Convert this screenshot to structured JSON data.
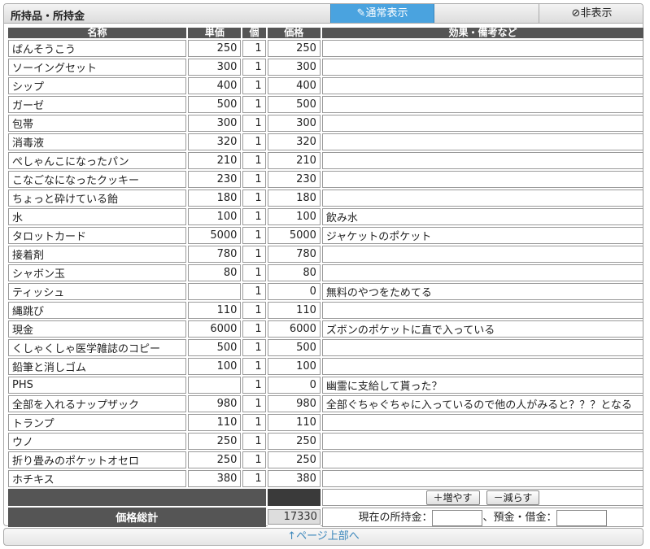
{
  "header": {
    "title": "所持品・所持金",
    "normal_label": "✎通常表示",
    "hide_label": "⊘非表示"
  },
  "table": {
    "columns": [
      "名称",
      "単価",
      "個",
      "価格",
      "効果・備考など"
    ],
    "rows": [
      {
        "name": "ばんそうこう",
        "unit": "250",
        "qty": "1",
        "price": "250",
        "note": ""
      },
      {
        "name": "ソーイングセット",
        "unit": "300",
        "qty": "1",
        "price": "300",
        "note": ""
      },
      {
        "name": "シップ",
        "unit": "400",
        "qty": "1",
        "price": "400",
        "note": ""
      },
      {
        "name": "ガーゼ",
        "unit": "500",
        "qty": "1",
        "price": "500",
        "note": ""
      },
      {
        "name": "包帯",
        "unit": "300",
        "qty": "1",
        "price": "300",
        "note": ""
      },
      {
        "name": "消毒液",
        "unit": "320",
        "qty": "1",
        "price": "320",
        "note": ""
      },
      {
        "name": "ぺしゃんこになったパン",
        "unit": "210",
        "qty": "1",
        "price": "210",
        "note": ""
      },
      {
        "name": "こなごなになったクッキー",
        "unit": "230",
        "qty": "1",
        "price": "230",
        "note": ""
      },
      {
        "name": "ちょっと砕けている飴",
        "unit": "180",
        "qty": "1",
        "price": "180",
        "note": ""
      },
      {
        "name": "水",
        "unit": "100",
        "qty": "1",
        "price": "100",
        "note": "飲み水"
      },
      {
        "name": "タロットカード",
        "unit": "5000",
        "qty": "1",
        "price": "5000",
        "note": "ジャケットのポケット"
      },
      {
        "name": "接着剤",
        "unit": "780",
        "qty": "1",
        "price": "780",
        "note": ""
      },
      {
        "name": "シャボン玉",
        "unit": "80",
        "qty": "1",
        "price": "80",
        "note": ""
      },
      {
        "name": "ティッシュ",
        "unit": "",
        "qty": "1",
        "price": "0",
        "note": "無料のやつをためてる"
      },
      {
        "name": "縄跳び",
        "unit": "110",
        "qty": "1",
        "price": "110",
        "note": ""
      },
      {
        "name": "現金",
        "unit": "6000",
        "qty": "1",
        "price": "6000",
        "note": "ズボンのポケットに直で入っている"
      },
      {
        "name": "くしゃくしゃ医学雑誌のコピー",
        "unit": "500",
        "qty": "1",
        "price": "500",
        "note": ""
      },
      {
        "name": "鉛筆と消しゴム",
        "unit": "100",
        "qty": "1",
        "price": "100",
        "note": ""
      },
      {
        "name": "PHS",
        "unit": "",
        "qty": "1",
        "price": "0",
        "note": "幽霊に支給して貰った？"
      },
      {
        "name": "全部を入れるナップザック",
        "unit": "980",
        "qty": "1",
        "price": "980",
        "note": "全部ぐちゃぐちゃに入っているので他の人がみると？？？となる"
      },
      {
        "name": "トランプ",
        "unit": "110",
        "qty": "1",
        "price": "110",
        "note": ""
      },
      {
        "name": "ウノ",
        "unit": "250",
        "qty": "1",
        "price": "250",
        "note": ""
      },
      {
        "name": "折り畳みのポケットオセロ",
        "unit": "250",
        "qty": "1",
        "price": "250",
        "note": ""
      },
      {
        "name": "ホチキス",
        "unit": "380",
        "qty": "1",
        "price": "380",
        "note": ""
      }
    ]
  },
  "controls": {
    "add_label": "＋増やす",
    "remove_label": "－減らす"
  },
  "summary": {
    "total_label": "価格総計",
    "total_value": "17330",
    "money_label": "現在の所持金：",
    "deposit_label": "、預金・借金："
  },
  "footer": {
    "top_link": "↑ページ上部へ"
  },
  "colors": {
    "accent": "#4aa3df",
    "header_bg": "#555555"
  }
}
